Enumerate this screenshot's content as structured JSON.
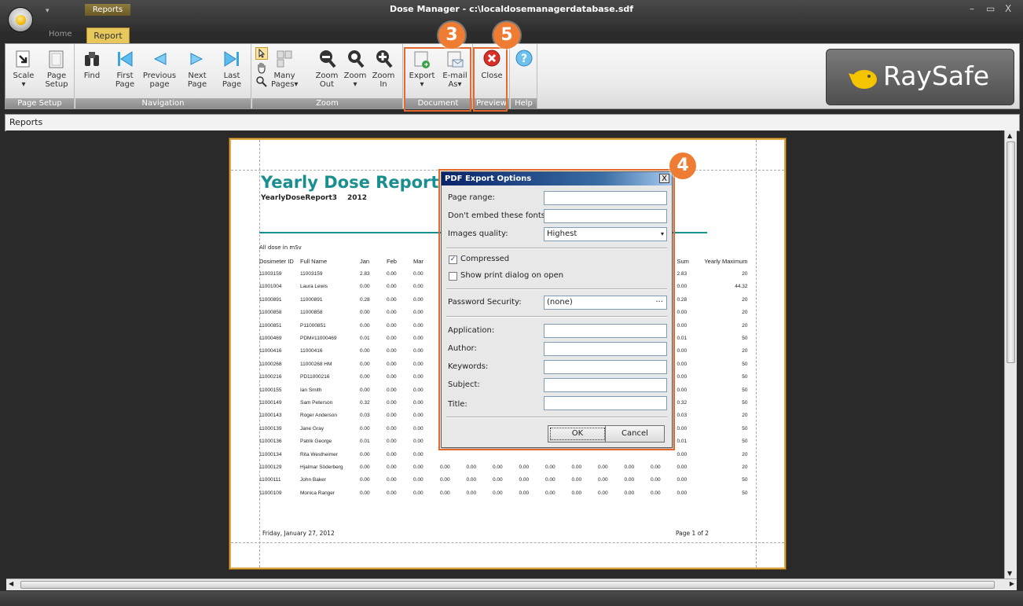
{
  "window": {
    "title": "Dose Manager - c:\\localdosemanagerdatabase.sdf",
    "context_tab_group": "Reports",
    "controls": [
      "–",
      "▭",
      "X"
    ]
  },
  "tabs": {
    "home": "Home",
    "report": "Report"
  },
  "ribbon": {
    "groups": {
      "page_setup": "Page Setup",
      "navigation": "Navigation",
      "zoom": "Zoom",
      "document": "Document",
      "preview": "Preview",
      "help": "Help"
    },
    "buttons": {
      "scale": "Scale",
      "page_setup_l1": "Page",
      "page_setup_l2": "Setup",
      "find": "Find",
      "first_l1": "First",
      "first_l2": "Page",
      "prev_l1": "Previous",
      "prev_l2": "page",
      "next_l1": "Next",
      "next_l2": "Page",
      "last_l1": "Last",
      "last_l2": "Page",
      "many_l1": "Many",
      "many_l2": "Pages",
      "zoom_out_l1": "Zoom",
      "zoom_out_l2": "Out",
      "zoom": "Zoom",
      "zoom_in_l1": "Zoom",
      "zoom_in_l2": "In",
      "export": "Export",
      "email_l1": "E-mail",
      "email_l2": "As",
      "close": "Close"
    }
  },
  "brand": {
    "name": "RaySafe"
  },
  "reports_strip": {
    "label": "Reports"
  },
  "report": {
    "title": "Yearly Dose Report",
    "subtitle": "YearlyDoseReport3",
    "year": "2012",
    "all_dose": "All dose in mSv",
    "columns": [
      "Dosimeter ID",
      "Full Name",
      "Jan",
      "Feb",
      "Mar",
      "Sum",
      "Yearly Maximum"
    ],
    "rows": [
      [
        "11003159",
        "11003159",
        "2.83",
        "0.00",
        "0.00",
        "2.83",
        "20"
      ],
      [
        "11001004",
        "Laura Lewis",
        "0.00",
        "0.00",
        "0.00",
        "0.00",
        "44.32"
      ],
      [
        "11000891",
        "11000891",
        "0.28",
        "0.00",
        "0.00",
        "0.28",
        "20"
      ],
      [
        "11000858",
        "11000858",
        "0.00",
        "0.00",
        "0.00",
        "0.00",
        "20"
      ],
      [
        "11000851",
        "P11000851",
        "0.00",
        "0.00",
        "0.00",
        "0.00",
        "20"
      ],
      [
        "11000469",
        "PDM#11000469",
        "0.01",
        "0.00",
        "0.00",
        "0.01",
        "50"
      ],
      [
        "11000416",
        "11000416",
        "0.00",
        "0.00",
        "0.00",
        "0.00",
        "20"
      ],
      [
        "11000268",
        "11000268 HM",
        "0.00",
        "0.00",
        "0.00",
        "0.00",
        "50"
      ],
      [
        "11000216",
        "PD11000216",
        "0.00",
        "0.00",
        "0.00",
        "0.00",
        "50"
      ],
      [
        "11000155",
        "Ian Smith",
        "0.00",
        "0.00",
        "0.00",
        "0.00",
        "50"
      ],
      [
        "11000149",
        "Sam Peterson",
        "0.32",
        "0.00",
        "0.00",
        "0.32",
        "50"
      ],
      [
        "11000143",
        "Roger Anderson",
        "0.03",
        "0.00",
        "0.00",
        "0.03",
        "20"
      ],
      [
        "11000139",
        "Jane Gray",
        "0.00",
        "0.00",
        "0.00",
        "0.00",
        "50"
      ],
      [
        "11000136",
        "Patrik George",
        "0.01",
        "0.00",
        "0.00",
        "0.01",
        "50"
      ],
      [
        "11000134",
        "Rita Westheimer",
        "0.00",
        "0.00",
        "0.00",
        "0.00",
        "20"
      ],
      [
        "11000129",
        "Hjalmar Söderberg",
        "0.00",
        "0.00",
        "0.00",
        "0.00",
        "20"
      ],
      [
        "11000111",
        "John Baker",
        "0.00",
        "0.00",
        "0.00",
        "0.00",
        "50"
      ],
      [
        "11000109",
        "Monica Ranger",
        "0.00",
        "0.00",
        "0.00",
        "0.00",
        "50"
      ]
    ],
    "extra_month_values": "0.00",
    "footer_date": "Friday, January 27, 2012",
    "footer_page": "Page 1 of 2"
  },
  "dialog": {
    "title": "PDF Export Options",
    "close": "X",
    "page_range_label": "Page range:",
    "page_range_value": "",
    "fonts_label": "Don't embed these fonts:",
    "fonts_value": "",
    "images_quality_label": "Images quality:",
    "images_quality_value": "Highest",
    "compressed_label": "Compressed",
    "compressed_checked": true,
    "show_print_label": "Show print dialog on open",
    "show_print_checked": false,
    "password_label": "Password Security:",
    "password_value": "(none)",
    "application_label": "Application:",
    "author_label": "Author:",
    "keywords_label": "Keywords:",
    "subject_label": "Subject:",
    "title_label": "Title:",
    "ok": "OK",
    "cancel": "Cancel"
  },
  "callouts": {
    "export": "3",
    "dialog": "4",
    "close": "5"
  },
  "colors": {
    "accent": "#ee7d33",
    "report_title": "#1a8f8f",
    "tab_active": "#e8c85c"
  }
}
